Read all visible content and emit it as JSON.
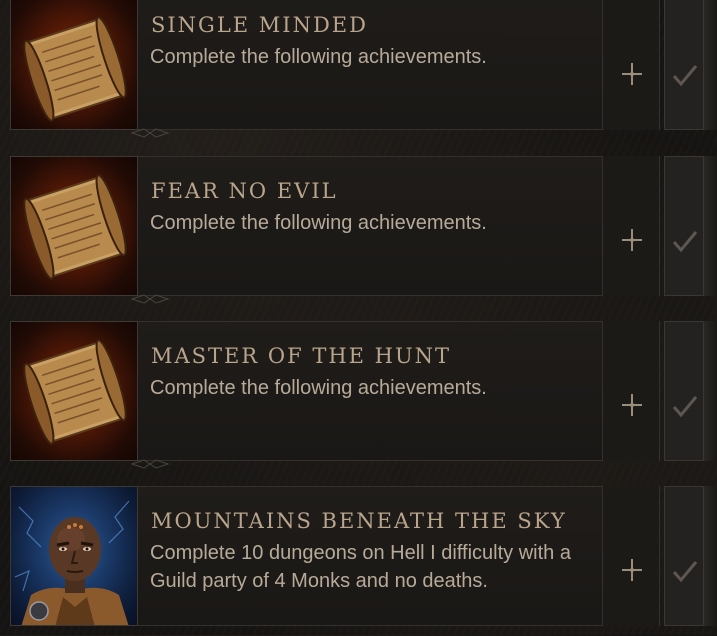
{
  "achievements": [
    {
      "title": "SINGLE MINDED",
      "description": "Complete the following achievements.",
      "icon": "scroll-icon",
      "track_icon": "cross-icon",
      "status_icon": "checkmark-icon"
    },
    {
      "title": "FEAR NO EVIL",
      "description": "Complete the following achievements.",
      "icon": "scroll-icon",
      "track_icon": "cross-icon",
      "status_icon": "checkmark-icon"
    },
    {
      "title": "MASTER OF THE HUNT",
      "description": "Complete the following achievements.",
      "icon": "scroll-icon",
      "track_icon": "cross-icon",
      "status_icon": "checkmark-icon"
    },
    {
      "title": "MOUNTAINS BENEATH THE SKY",
      "description": "Complete 10 dungeons on Hell I difficulty with a Guild party of 4 Monks and no deaths.",
      "icon": "monk-portrait-icon",
      "track_icon": "cross-icon",
      "status_icon": "checkmark-icon"
    }
  ],
  "colors": {
    "title": "#b9a58b",
    "description": "#b7aa98",
    "panel": "#1c1a17",
    "border": "#35302b"
  }
}
